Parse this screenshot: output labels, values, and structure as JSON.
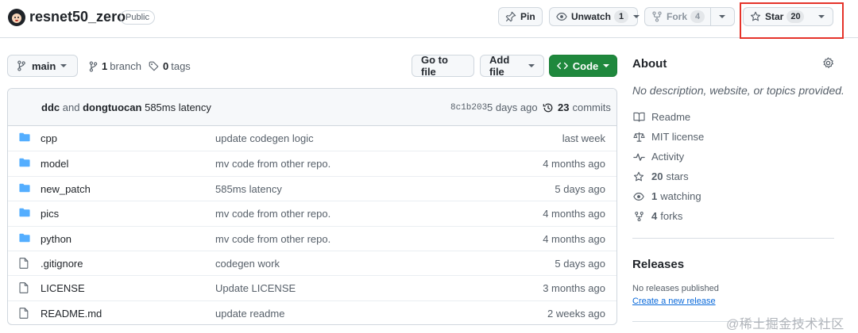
{
  "repo": {
    "name": "resnet50_zero",
    "visibility": "Public"
  },
  "header_actions": {
    "pin_label": "Pin",
    "unwatch_label": "Unwatch",
    "watch_count": "1",
    "fork_label": "Fork",
    "fork_count": "4",
    "star_label": "Star",
    "star_count": "20"
  },
  "toolbar": {
    "branch": "main",
    "branch_count": "1",
    "branch_label": "branch",
    "tag_count": "0",
    "tag_label": "tags",
    "go_to_file": "Go to file",
    "add_file": "Add file",
    "code": "Code"
  },
  "latest_commit": {
    "author1": "ddc",
    "and": "and",
    "author2": "dongtuocan",
    "message": "585ms latency",
    "sha": "8c1b203",
    "time": "5 days ago",
    "commit_count": "23",
    "commits_label": "commits"
  },
  "files": [
    {
      "type": "dir",
      "name": "cpp",
      "message": "update codegen logic",
      "age": "last week"
    },
    {
      "type": "dir",
      "name": "model",
      "message": "mv code from other repo.",
      "age": "4 months ago"
    },
    {
      "type": "dir",
      "name": "new_patch",
      "message": "585ms latency",
      "age": "5 days ago"
    },
    {
      "type": "dir",
      "name": "pics",
      "message": "mv code from other repo.",
      "age": "4 months ago"
    },
    {
      "type": "dir",
      "name": "python",
      "message": "mv code from other repo.",
      "age": "4 months ago"
    },
    {
      "type": "file",
      "name": ".gitignore",
      "message": "codegen work",
      "age": "5 days ago"
    },
    {
      "type": "file",
      "name": "LICENSE",
      "message": "Update LICENSE",
      "age": "3 months ago"
    },
    {
      "type": "file",
      "name": "README.md",
      "message": "update readme",
      "age": "2 weeks ago"
    }
  ],
  "about": {
    "title": "About",
    "description": "No description, website, or topics provided.",
    "readme": "Readme",
    "license": "MIT license",
    "activity": "Activity",
    "stars_count": "20",
    "stars_label": "stars",
    "watching_count": "1",
    "watching_label": "watching",
    "forks_count": "4",
    "forks_label": "forks"
  },
  "releases": {
    "title": "Releases",
    "none": "No releases published",
    "create": "Create a new release"
  },
  "watermark": "@稀土掘金技术社区",
  "colors": {
    "code_button": "#1f883d",
    "folder": "#54aeff",
    "link": "#0969da",
    "highlight": "#e5332a"
  }
}
